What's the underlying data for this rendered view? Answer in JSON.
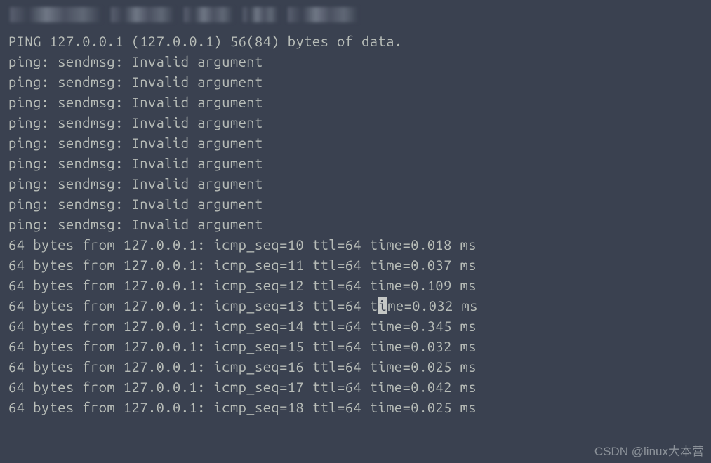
{
  "terminal": {
    "header": "PING 127.0.0.1 (127.0.0.1) 56(84) bytes of data.",
    "error_lines": [
      "ping: sendmsg: Invalid argument",
      "ping: sendmsg: Invalid argument",
      "ping: sendmsg: Invalid argument",
      "ping: sendmsg: Invalid argument",
      "ping: sendmsg: Invalid argument",
      "ping: sendmsg: Invalid argument",
      "ping: sendmsg: Invalid argument",
      "ping: sendmsg: Invalid argument",
      "ping: sendmsg: Invalid argument"
    ],
    "reply_lines": [
      {
        "text": "64 bytes from 127.0.0.1: icmp_seq=10 ttl=64 time=0.018 ms",
        "cursor": false
      },
      {
        "text": "64 bytes from 127.0.0.1: icmp_seq=11 ttl=64 time=0.037 ms",
        "cursor": false
      },
      {
        "text": "64 bytes from 127.0.0.1: icmp_seq=12 ttl=64 time=0.109 ms",
        "cursor": false
      },
      {
        "pre": "64 bytes from 127.0.0.1: icmp_seq=13 ttl=64 t",
        "cur": "i",
        "post": "me=0.032 ms",
        "cursor": true
      },
      {
        "text": "64 bytes from 127.0.0.1: icmp_seq=14 ttl=64 time=0.345 ms",
        "cursor": false
      },
      {
        "text": "64 bytes from 127.0.0.1: icmp_seq=15 ttl=64 time=0.032 ms",
        "cursor": false
      },
      {
        "text": "64 bytes from 127.0.0.1: icmp_seq=16 ttl=64 time=0.025 ms",
        "cursor": false
      },
      {
        "text": "64 bytes from 127.0.0.1: icmp_seq=17 ttl=64 time=0.042 ms",
        "cursor": false
      },
      {
        "text": "64 bytes from 127.0.0.1: icmp_seq=18 ttl=64 time=0.025 ms",
        "cursor": false
      }
    ]
  },
  "watermark": "CSDN @linux大本营"
}
